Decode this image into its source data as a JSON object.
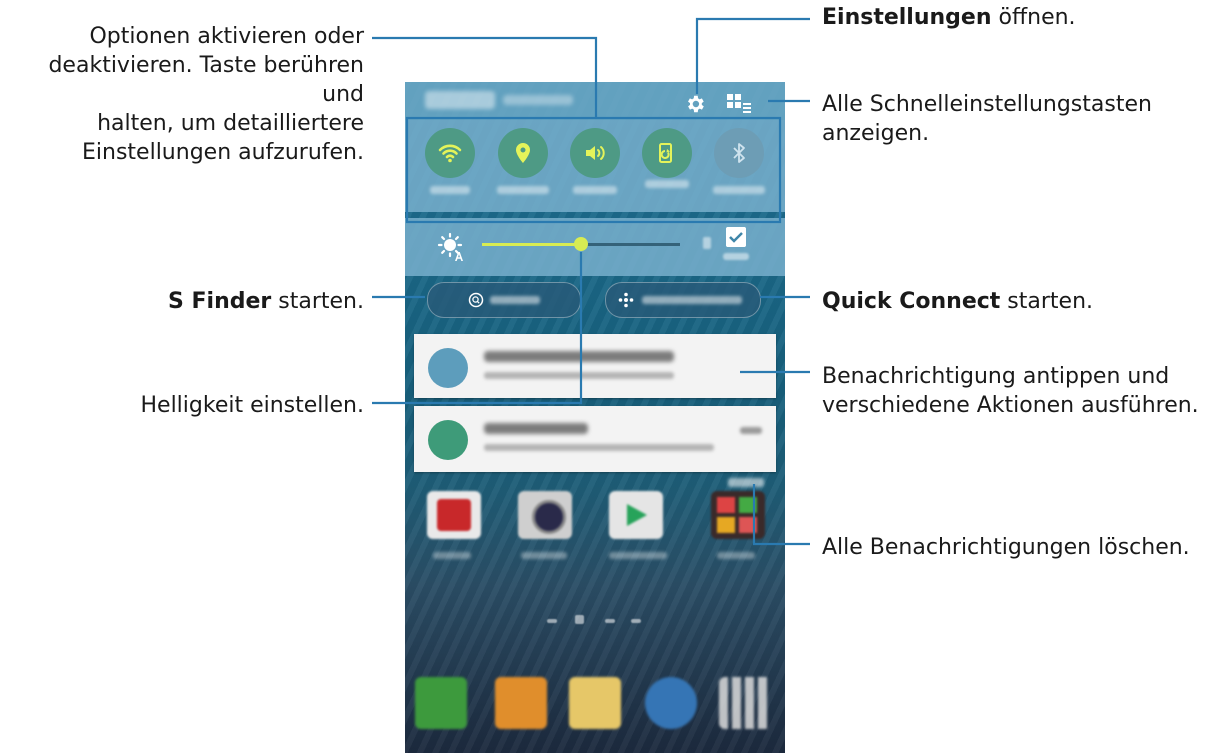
{
  "annotations": {
    "quick_settings": {
      "line1": "Optionen aktivieren oder",
      "line2": "deaktivieren. Taste berühren und",
      "line3": "halten, um detailliertere",
      "line4": "Einstellungen aufzurufen."
    },
    "s_finder": {
      "bold": "S Finder",
      "rest": " starten."
    },
    "brightness": {
      "text": "Helligkeit einstellen."
    },
    "settings": {
      "bold": "Einstellungen",
      "rest": " öffnen."
    },
    "all_quick_settings": {
      "line1": "Alle Schnelleinstellungstasten",
      "line2": "anzeigen."
    },
    "quick_connect": {
      "bold": "Quick Connect",
      "rest": " starten."
    },
    "notification_tap": {
      "line1": "Benachrichtigung antippen und",
      "line2": "verschiedene Aktionen ausführen."
    },
    "clear_all": {
      "text": "Alle Benachrichtigungen löschen."
    }
  },
  "phone": {
    "quick_buttons": [
      {
        "id": "wifi",
        "icon": "wifi-icon",
        "state": "on"
      },
      {
        "id": "location",
        "icon": "location-icon",
        "state": "on"
      },
      {
        "id": "sound",
        "icon": "sound-icon",
        "state": "on"
      },
      {
        "id": "screen-rotation",
        "icon": "screen-rotation-icon",
        "state": "on"
      },
      {
        "id": "bluetooth",
        "icon": "bluetooth-icon",
        "state": "off"
      }
    ],
    "brightness": {
      "level": 0.5,
      "auto_checked": true
    },
    "pills": [
      {
        "icon": "s-finder-icon"
      },
      {
        "icon": "quick-connect-icon"
      }
    ],
    "colors": {
      "accent": "#d8ec52",
      "toggle_on": "#4e9a85",
      "toggle_off": "#6d9db5",
      "callout_line": "#2a7ab0"
    }
  }
}
